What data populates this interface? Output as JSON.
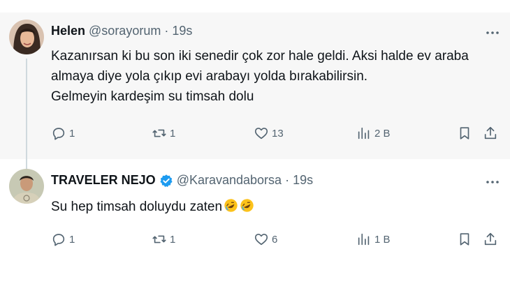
{
  "tweets": [
    {
      "name": "Helen",
      "handle": "@sorayorum",
      "separator": "·",
      "time": "19s",
      "verified": false,
      "text_lines": [
        "Kazanırsan ki bu son iki senedir çok zor hale geldi. Aksi halde ev araba",
        "almaya diye yola çıkıp evi arabayı yolda bırakabilirsin.",
        "Gelmeyin kardeşim su timsah dolu"
      ],
      "replies": "1",
      "reposts": "1",
      "likes": "13",
      "views": "2 B"
    },
    {
      "name": "TRAVELER NEJO",
      "handle": "@Karavandaborsa",
      "separator": "·",
      "time": "19s",
      "verified": true,
      "text_lines": [
        "Su hep timsah doluydu zaten"
      ],
      "emojis": [
        "rolling-on-floor-laughing",
        "rolling-on-floor-laughing"
      ],
      "replies": "1",
      "reposts": "1",
      "likes": "6",
      "views": "1 B"
    }
  ],
  "icons": {
    "reply": "speech-bubble-icon",
    "repost": "repost-arrows-icon",
    "like": "heart-icon",
    "views": "bar-chart-icon",
    "bookmark": "bookmark-icon",
    "share": "share-upload-icon",
    "more": "more-dots-icon",
    "verified": "verified-badge-icon"
  },
  "colors": {
    "text": "#0f1419",
    "secondary": "#536471",
    "verified": "#1d9bf0",
    "highlight_bg": "#f7f7f7",
    "thread_line": "#cfd9de"
  }
}
